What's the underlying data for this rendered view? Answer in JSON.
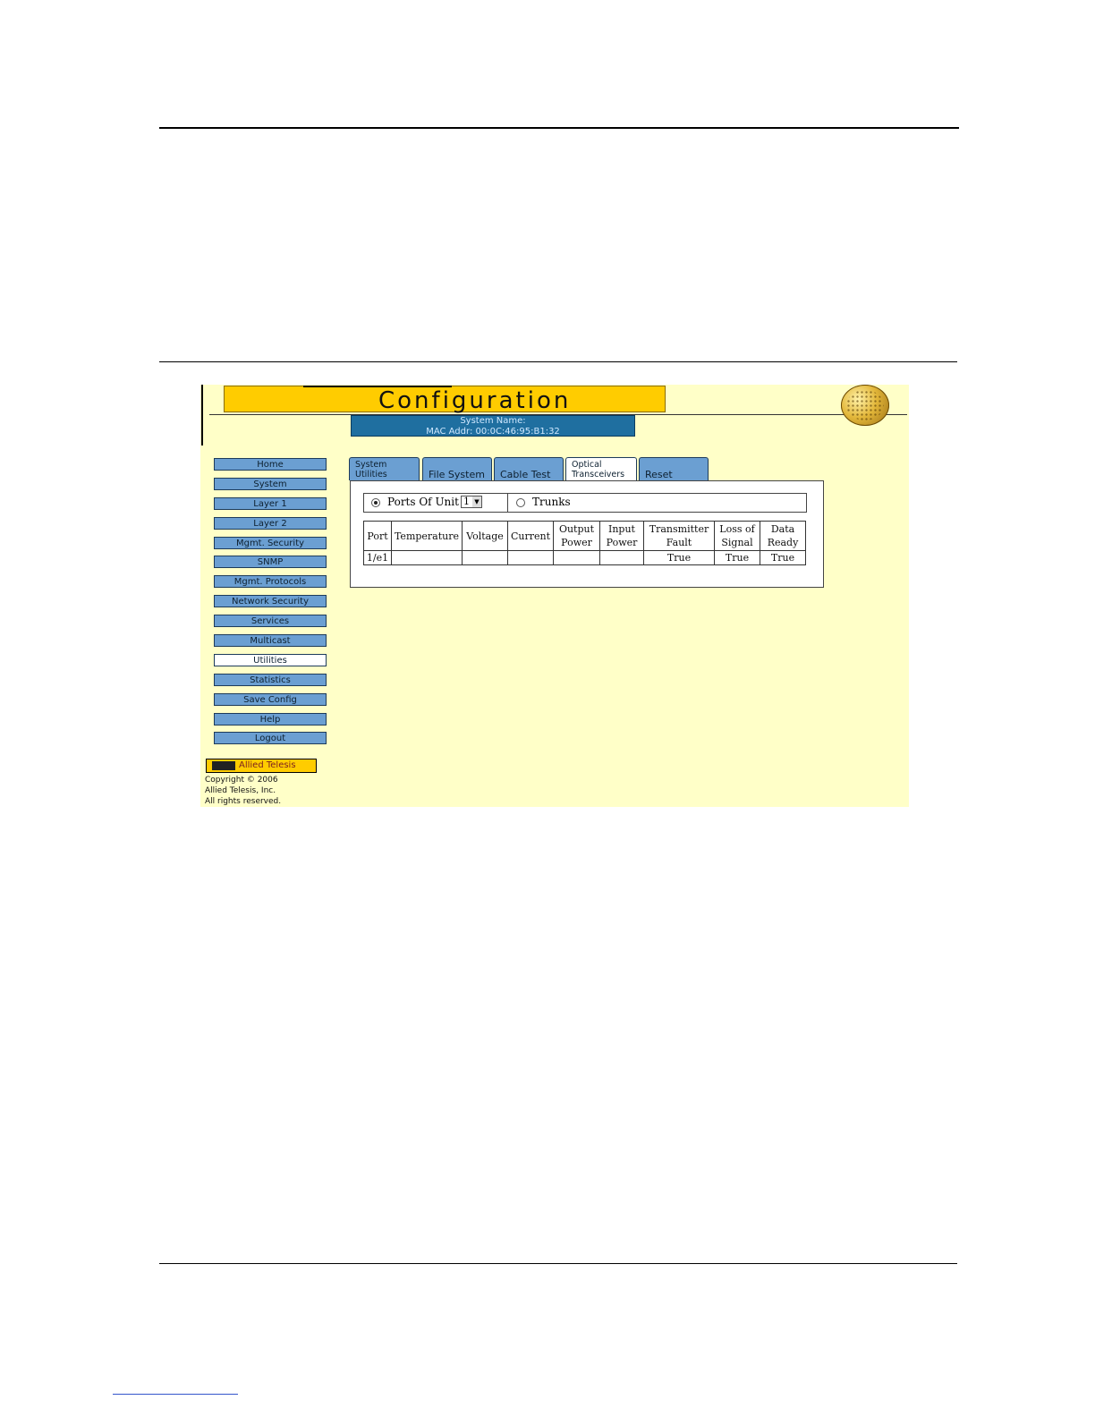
{
  "header": {
    "title": "Configuration"
  },
  "system": {
    "name_line": "System Name:",
    "mac_line": "MAC Addr: 00:0C:46:95:B1:32"
  },
  "nav": [
    {
      "label": "Home"
    },
    {
      "label": "System"
    },
    {
      "label": "Layer 1"
    },
    {
      "label": "Layer 2"
    },
    {
      "label": "Mgmt. Security"
    },
    {
      "label": "SNMP"
    },
    {
      "label": "Mgmt. Protocols"
    },
    {
      "label": "Network Security"
    },
    {
      "label": "Services"
    },
    {
      "label": "Multicast"
    },
    {
      "label": "Utilities"
    },
    {
      "label": "Statistics"
    },
    {
      "label": "Save Config"
    },
    {
      "label": "Help"
    },
    {
      "label": "Logout"
    }
  ],
  "tabs": [
    {
      "line1": "System",
      "line2": "Utilities"
    },
    {
      "label": "File System"
    },
    {
      "label": "Cable Test"
    },
    {
      "line1": "Optical",
      "line2": "Transceivers"
    },
    {
      "label": "Reset"
    }
  ],
  "selector": {
    "ports_label": "Ports Of Unit",
    "unit_value": "1",
    "trunks_label": "Trunks"
  },
  "table": {
    "headers": [
      [
        "Port"
      ],
      [
        "Temperature"
      ],
      [
        "Voltage"
      ],
      [
        "Current"
      ],
      [
        "Output",
        "Power"
      ],
      [
        "Input",
        "Power"
      ],
      [
        "Transmitter",
        "Fault"
      ],
      [
        "Loss of",
        "Signal"
      ],
      [
        "Data",
        "Ready"
      ]
    ],
    "rows": [
      [
        "1/e1",
        "",
        "",
        "",
        "",
        "",
        "True",
        "True",
        "True"
      ]
    ]
  },
  "footer": {
    "logo_text": "Allied Telesis",
    "copyright": [
      "Copyright © 2006",
      "Allied Telesis, Inc.",
      "All rights reserved."
    ]
  }
}
